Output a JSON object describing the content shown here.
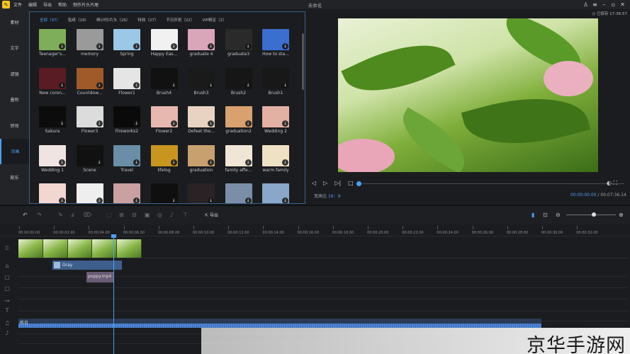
{
  "app": {
    "logo_glyph": "✎",
    "menu": [
      "文件",
      "编辑",
      "导出",
      "帮助",
      "制作片头片尾"
    ],
    "window_title": "未命名",
    "autosave": "◷ 已保存 17:36:57"
  },
  "sidebar": {
    "items": [
      "素材",
      "文字",
      "滤镜",
      "叠附",
      "转场",
      "动画",
      "配乐"
    ],
    "active_index": 5
  },
  "library": {
    "tabs": [
      "全部（97）",
      "贴纸（19）",
      "倒计时/片头（26）",
      "特效（27）",
      "节日庆祝（22）",
      "VIP精定（2）"
    ],
    "active_tab": 0,
    "download_glyph": "↓",
    "items": [
      {
        "label": "Teenager's...",
        "color": "#7fae5a"
      },
      {
        "label": "memory",
        "color": "#9a9a9a"
      },
      {
        "label": "Spring",
        "color": "#9cc8e8"
      },
      {
        "label": "Happy Eas...",
        "color": "#f1f1f1"
      },
      {
        "label": "graduate 4",
        "color": "#d9a6b9"
      },
      {
        "label": "graduate3",
        "color": "#2a2a2a"
      },
      {
        "label": "How to sta...",
        "color": "#3a6fd0"
      },
      {
        "label": "New coron...",
        "color": "#5a1c24"
      },
      {
        "label": "Countdow...",
        "color": "#a05a2a"
      },
      {
        "label": "Flower1",
        "color": "#e5e5e5"
      },
      {
        "label": "Brush4",
        "color": "#111111"
      },
      {
        "label": "Brush3",
        "color": "#1a1a1a"
      },
      {
        "label": "Brush2",
        "color": "#161616"
      },
      {
        "label": "Brush1",
        "color": "#181818"
      },
      {
        "label": "Sakura",
        "color": "#0c0c0c"
      },
      {
        "label": "Flower3",
        "color": "#dcdcdc"
      },
      {
        "label": "Fireworks2",
        "color": "#0a0a0a"
      },
      {
        "label": "Flower2",
        "color": "#e6b8b0"
      },
      {
        "label": "Defeat the...",
        "color": "#e8d2c2"
      },
      {
        "label": "graduation2",
        "color": "#d9a070"
      },
      {
        "label": "Wedding 2",
        "color": "#e3b0a4"
      },
      {
        "label": "Wedding 1",
        "color": "#f0e4e2"
      },
      {
        "label": "Scene",
        "color": "#111111"
      },
      {
        "label": "Travel",
        "color": "#6a8ea8"
      },
      {
        "label": "lifelog",
        "color": "#c8961e"
      },
      {
        "label": "graduation",
        "color": "#c8a070"
      },
      {
        "label": "family affe...",
        "color": "#f1e6d6"
      },
      {
        "label": "warm family",
        "color": "#efe2c4"
      },
      {
        "label": "",
        "color": "#f2d6d0"
      },
      {
        "label": "",
        "color": "#eeeeee"
      },
      {
        "label": "",
        "color": "#caa0a0"
      },
      {
        "label": "",
        "color": "#0f0f0f"
      },
      {
        "label": "",
        "color": "#2a2224"
      },
      {
        "label": "",
        "color": "#7a8ea8"
      },
      {
        "label": "",
        "color": "#8aa6c8"
      }
    ]
  },
  "player": {
    "prev_glyph": "◁",
    "play_glyph": "▷",
    "next_glyph": "▷|",
    "stop_glyph": "□",
    "ratio_label": "宽高比",
    "ratio_value": "16：9",
    "current_time": "00:00:00.00",
    "total_time": "/ 00:07:36.14",
    "progress": 0.0,
    "snapshot_glyph": "◐",
    "fullscreen_glyph": "⛶"
  },
  "toolbar": {
    "export_label": "导出",
    "tools": [
      "↶",
      "↷",
      "✎",
      "⫝̸",
      "⌦",
      "⬚",
      "⊞",
      "⊟",
      "▣",
      "◎",
      "♪",
      "⊤"
    ],
    "right_tools": [
      "▮",
      "⊡",
      "⊖",
      "⊕"
    ],
    "zoom_level": 0.55
  },
  "timeline": {
    "ticks": [
      "00:00:00.00",
      "00:00:02.00",
      "00:00:04.00",
      "00:00:06.00",
      "00:00:08.00",
      "00:00:10.00",
      "00:00:12.00",
      "00:00:14.00",
      "00:00:16.00",
      "00:00:18.00",
      "00:00:20.00",
      "00:00:22.00",
      "00:00:24.00",
      "00:00:26.00",
      "00:00:28.00",
      "00:00:30.00",
      "00:00:32.00"
    ],
    "track_icons": [
      "▯",
      "⌂",
      "▢",
      "▢",
      "↝",
      "T",
      "♫",
      "♪"
    ],
    "clips": {
      "filter": "Gray",
      "overlay": "poppy.mp4",
      "audio": "昨日"
    }
  },
  "watermark": "京华手游网"
}
